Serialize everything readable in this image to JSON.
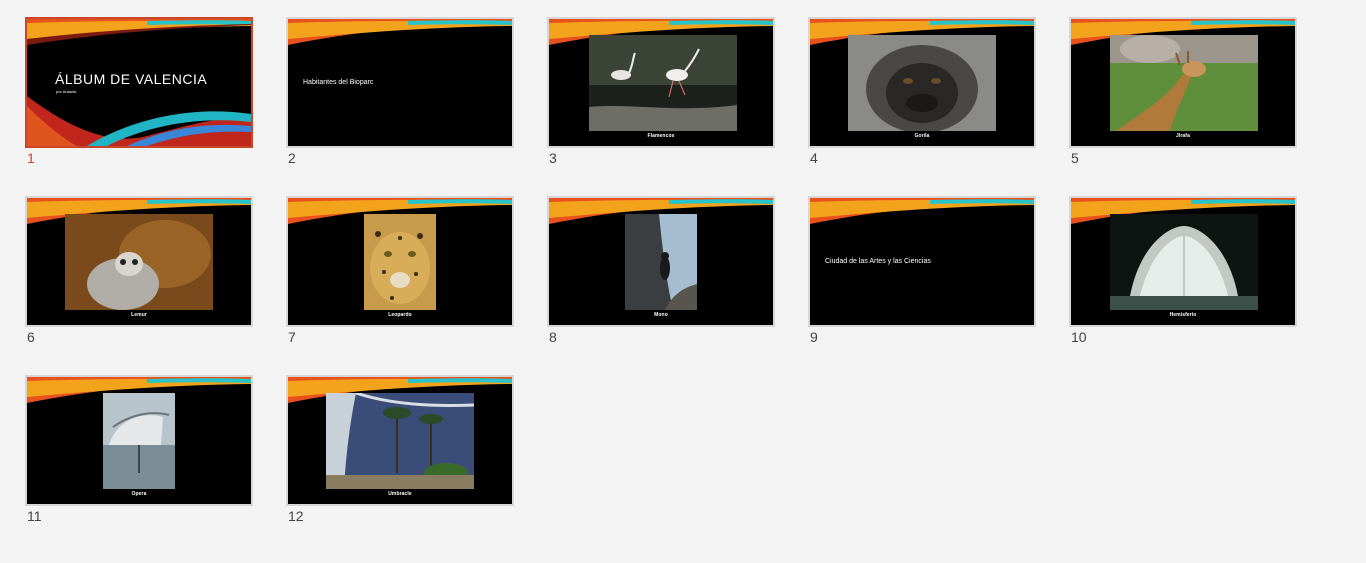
{
  "slides": [
    {
      "number": "1",
      "type": "title",
      "title": "ÁLBUM DE VALENCIA",
      "subtitle": "por Aulaclic",
      "selected": true
    },
    {
      "number": "2",
      "type": "section",
      "title": "Habitantes del Bioparc"
    },
    {
      "number": "3",
      "type": "photo",
      "caption": "Flamencos",
      "photo": "flamingos-photo"
    },
    {
      "number": "4",
      "type": "photo",
      "caption": "Gorila",
      "photo": "gorilla-photo"
    },
    {
      "number": "5",
      "type": "photo",
      "caption": "Jirafa",
      "photo": "giraffe-photo"
    },
    {
      "number": "6",
      "type": "photo",
      "caption": "Lemur",
      "photo": "lemur-photo"
    },
    {
      "number": "7",
      "type": "photo",
      "caption": "Leopardo",
      "photo": "leopard-photo"
    },
    {
      "number": "8",
      "type": "photo",
      "caption": "Mono",
      "photo": "monkey-photo"
    },
    {
      "number": "9",
      "type": "section",
      "title": "Ciudad de las Artes y las Ciencias"
    },
    {
      "number": "10",
      "type": "photo",
      "caption": "Hemisferio",
      "photo": "hemisferic-photo"
    },
    {
      "number": "11",
      "type": "photo",
      "caption": "Opera",
      "photo": "opera-photo"
    },
    {
      "number": "12",
      "type": "photo",
      "caption": "Umbracle",
      "photo": "umbracle-photo"
    }
  ],
  "colors": {
    "selection": "#c8462a",
    "background": "#f3f3f3",
    "slide_background": "#000000"
  }
}
